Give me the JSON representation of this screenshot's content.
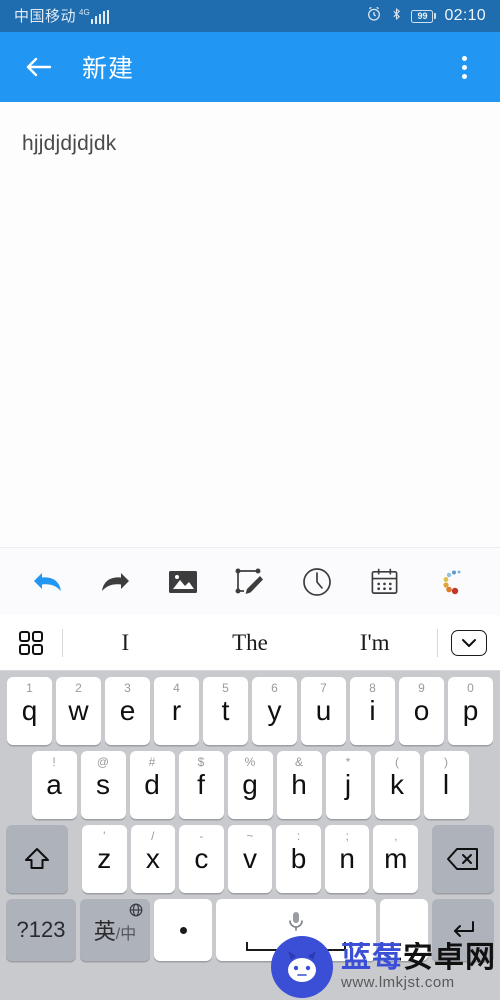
{
  "status_bar": {
    "carrier": "中国移动",
    "network_label": "4G",
    "signal_icon": "signal-bars-icon",
    "alarm_icon": "alarm-clock-icon",
    "bluetooth_icon": "bluetooth-icon",
    "battery_percent": "99",
    "time": "02:10",
    "background_color": "#1f6cae"
  },
  "app_bar": {
    "back_icon": "back-arrow-icon",
    "title": "新建",
    "overflow_icon": "overflow-menu-icon",
    "background_color": "#2196f3"
  },
  "note": {
    "text": "hjjdjdjdjdk",
    "background_color": "#fdfdfd"
  },
  "edit_toolbar": {
    "buttons": [
      {
        "name": "undo-icon",
        "label": "undo"
      },
      {
        "name": "redo-icon",
        "label": "redo"
      },
      {
        "name": "image-icon",
        "label": "insert image"
      },
      {
        "name": "handwriting-icon",
        "label": "handwriting"
      },
      {
        "name": "clock-icon",
        "label": "time"
      },
      {
        "name": "calendar-icon",
        "label": "date"
      },
      {
        "name": "ai-dots-icon",
        "label": "smart assist"
      }
    ],
    "undo_color": "#2196f3",
    "icon_color": "#3d3d3d"
  },
  "suggestion_bar": {
    "grid_icon": "app-grid-icon",
    "words": [
      "I",
      "The",
      "I'm"
    ],
    "collapse_icon": "chevron-down-icon"
  },
  "keyboard": {
    "background_color": "#c8cace",
    "key_color": "#ffffff",
    "fn_key_color": "#aeb2bb",
    "row1": [
      {
        "main": "q",
        "sup": "1"
      },
      {
        "main": "w",
        "sup": "2"
      },
      {
        "main": "e",
        "sup": "3"
      },
      {
        "main": "r",
        "sup": "4"
      },
      {
        "main": "t",
        "sup": "5"
      },
      {
        "main": "y",
        "sup": "6"
      },
      {
        "main": "u",
        "sup": "7"
      },
      {
        "main": "i",
        "sup": "8"
      },
      {
        "main": "o",
        "sup": "9"
      },
      {
        "main": "p",
        "sup": "0"
      }
    ],
    "row2": [
      {
        "main": "a",
        "sup": "!"
      },
      {
        "main": "s",
        "sup": "@"
      },
      {
        "main": "d",
        "sup": "#"
      },
      {
        "main": "f",
        "sup": "$"
      },
      {
        "main": "g",
        "sup": "%"
      },
      {
        "main": "h",
        "sup": "&"
      },
      {
        "main": "j",
        "sup": "*"
      },
      {
        "main": "k",
        "sup": "("
      },
      {
        "main": "l",
        "sup": ")"
      }
    ],
    "row3": [
      {
        "main": "z",
        "sup": "'"
      },
      {
        "main": "x",
        "sup": "/"
      },
      {
        "main": "c",
        "sup": "-"
      },
      {
        "main": "v",
        "sup": "~"
      },
      {
        "main": "b",
        "sup": ":"
      },
      {
        "main": "n",
        "sup": ";"
      },
      {
        "main": "m",
        "sup": ","
      }
    ],
    "shift_icon": "shift-up-arrow-icon",
    "backspace_icon": "backspace-delete-icon",
    "symbols_key": "?123",
    "lang_key": {
      "primary": "英",
      "sep": "/",
      "secondary": "中",
      "globe_icon": "globe-icon"
    },
    "period_key": "period-dot-icon",
    "space_key": {
      "mic_icon": "microphone-icon",
      "label": ""
    },
    "enter_icon": "enter-return-icon"
  },
  "watermark": {
    "logo_icon": "blueberry-android-logo-icon",
    "site_name": "蓝莓安卓网",
    "url": "www.lmkjst.com"
  }
}
